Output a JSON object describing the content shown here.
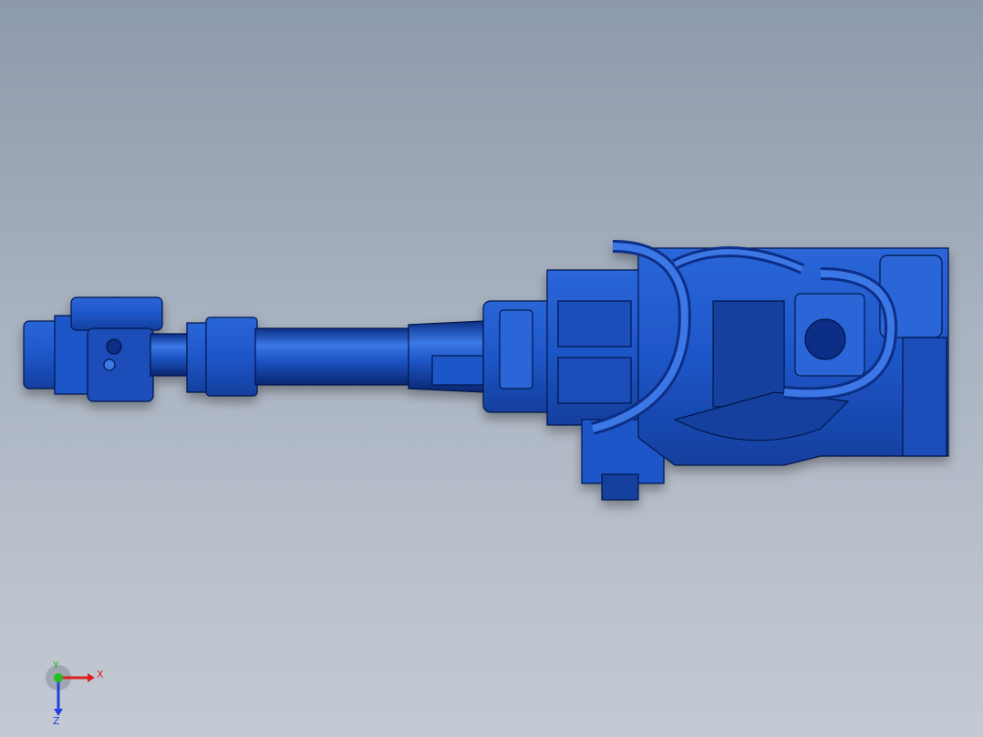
{
  "viewport": {
    "background_top": "#8d9aab",
    "background_bottom": "#c4cad3",
    "model_color": "#1e56c8",
    "model_dark": "#0b2f86",
    "model_light": "#3b78e6"
  },
  "triad": {
    "x_label": "X",
    "y_label": "Y",
    "z_label": "Z",
    "x_color": "#e02020",
    "y_color": "#20c020",
    "z_color": "#2040e0"
  }
}
